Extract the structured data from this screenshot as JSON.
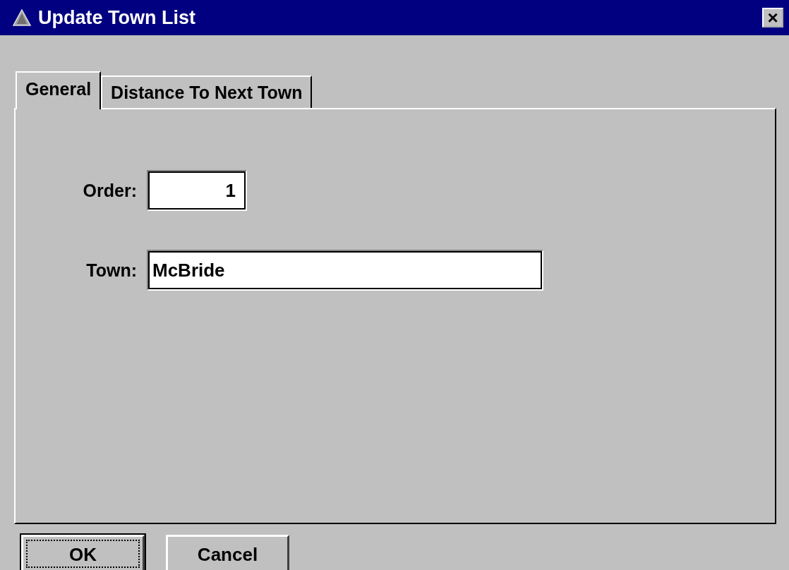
{
  "window": {
    "title": "Update Town List",
    "close": "×"
  },
  "tabs": [
    {
      "label": "General",
      "selected": true
    },
    {
      "label": "Distance To Next Town",
      "selected": false
    }
  ],
  "fields": [
    {
      "label": "Order:",
      "value": "1",
      "kind": "number"
    },
    {
      "label": "Town:",
      "value": "McBride",
      "kind": "text"
    }
  ],
  "buttons": [
    {
      "label": "OK",
      "focused": true
    },
    {
      "label": "Cancel",
      "focused": false
    }
  ]
}
